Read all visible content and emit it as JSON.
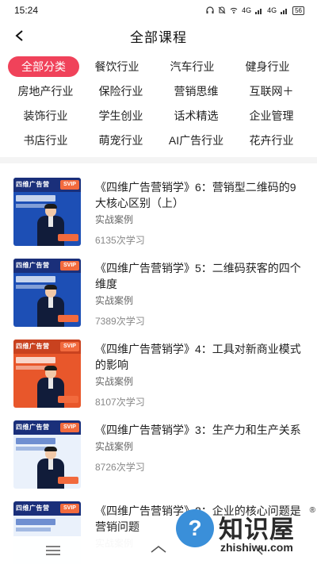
{
  "status": {
    "time": "15:24",
    "net1": "4G",
    "net2": "4G",
    "battery": "56"
  },
  "header": {
    "title": "全部课程"
  },
  "categories": [
    [
      "全部分类",
      "餐饮行业",
      "汽车行业",
      "健身行业"
    ],
    [
      "房地产行业",
      "保险行业",
      "营销思维",
      "互联网＋"
    ],
    [
      "装饰行业",
      "学生创业",
      "话术精选",
      "企业管理"
    ],
    [
      "书店行业",
      "萌宠行业",
      "AI广告行业",
      "花卉行业"
    ]
  ],
  "courses": [
    {
      "title": "《四维广告营销学》6：营销型二维码的9大核心区别（上）",
      "type": "实战案例",
      "count": "6135次学习",
      "thumb_brand": "四维广告营",
      "thumb_badge": "SVIP"
    },
    {
      "title": "《四维广告营销学》5：二维码获客的四个维度",
      "type": "实战案例",
      "count": "7389次学习",
      "thumb_brand": "四维广告营",
      "thumb_badge": "SVIP"
    },
    {
      "title": "《四维广告营销学》4：工具对新商业模式的影响",
      "type": "实战案例",
      "count": "8107次学习",
      "thumb_brand": "四维广告营",
      "thumb_badge": "SVIP"
    },
    {
      "title": "《四维广告营销学》3：生产力和生产关系",
      "type": "实战案例",
      "count": "8726次学习",
      "thumb_brand": "四维广告营",
      "thumb_badge": "SVIP"
    },
    {
      "title": "《四维广告营销学》2：企业的核心问题是营销问题",
      "type": "实战案例",
      "count": "",
      "thumb_brand": "四维广告营",
      "thumb_badge": "SVIP"
    }
  ],
  "watermark": {
    "name": "知识屋",
    "url": "zhishiwu.com",
    "mark": "?",
    "reg": "®"
  }
}
